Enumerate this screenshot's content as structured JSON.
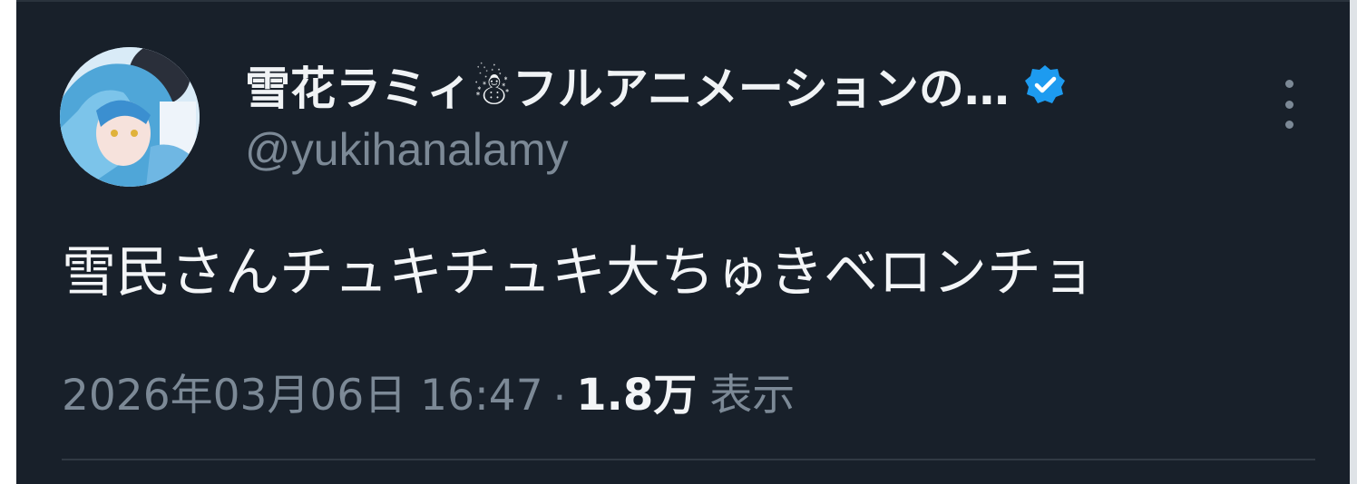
{
  "tweet": {
    "author": {
      "display_name": "雪花ラミィ☃フルアニメーションの…",
      "handle": "@yukihanalamy",
      "verified": true,
      "avatar_icon": "user-avatar"
    },
    "text": "雪民さんチュキチュキ大ちゅきベロンチョ",
    "meta": {
      "timestamp": "2026年03月06日 16:47",
      "separator": "·",
      "views_count": "1.8万",
      "views_label": "表示"
    },
    "more_icon": "more-vertical-icon"
  },
  "colors": {
    "background": "#18202a",
    "text_primary": "#f3f5f7",
    "text_secondary": "#7c8996",
    "verified_blue": "#1d9bf0"
  }
}
